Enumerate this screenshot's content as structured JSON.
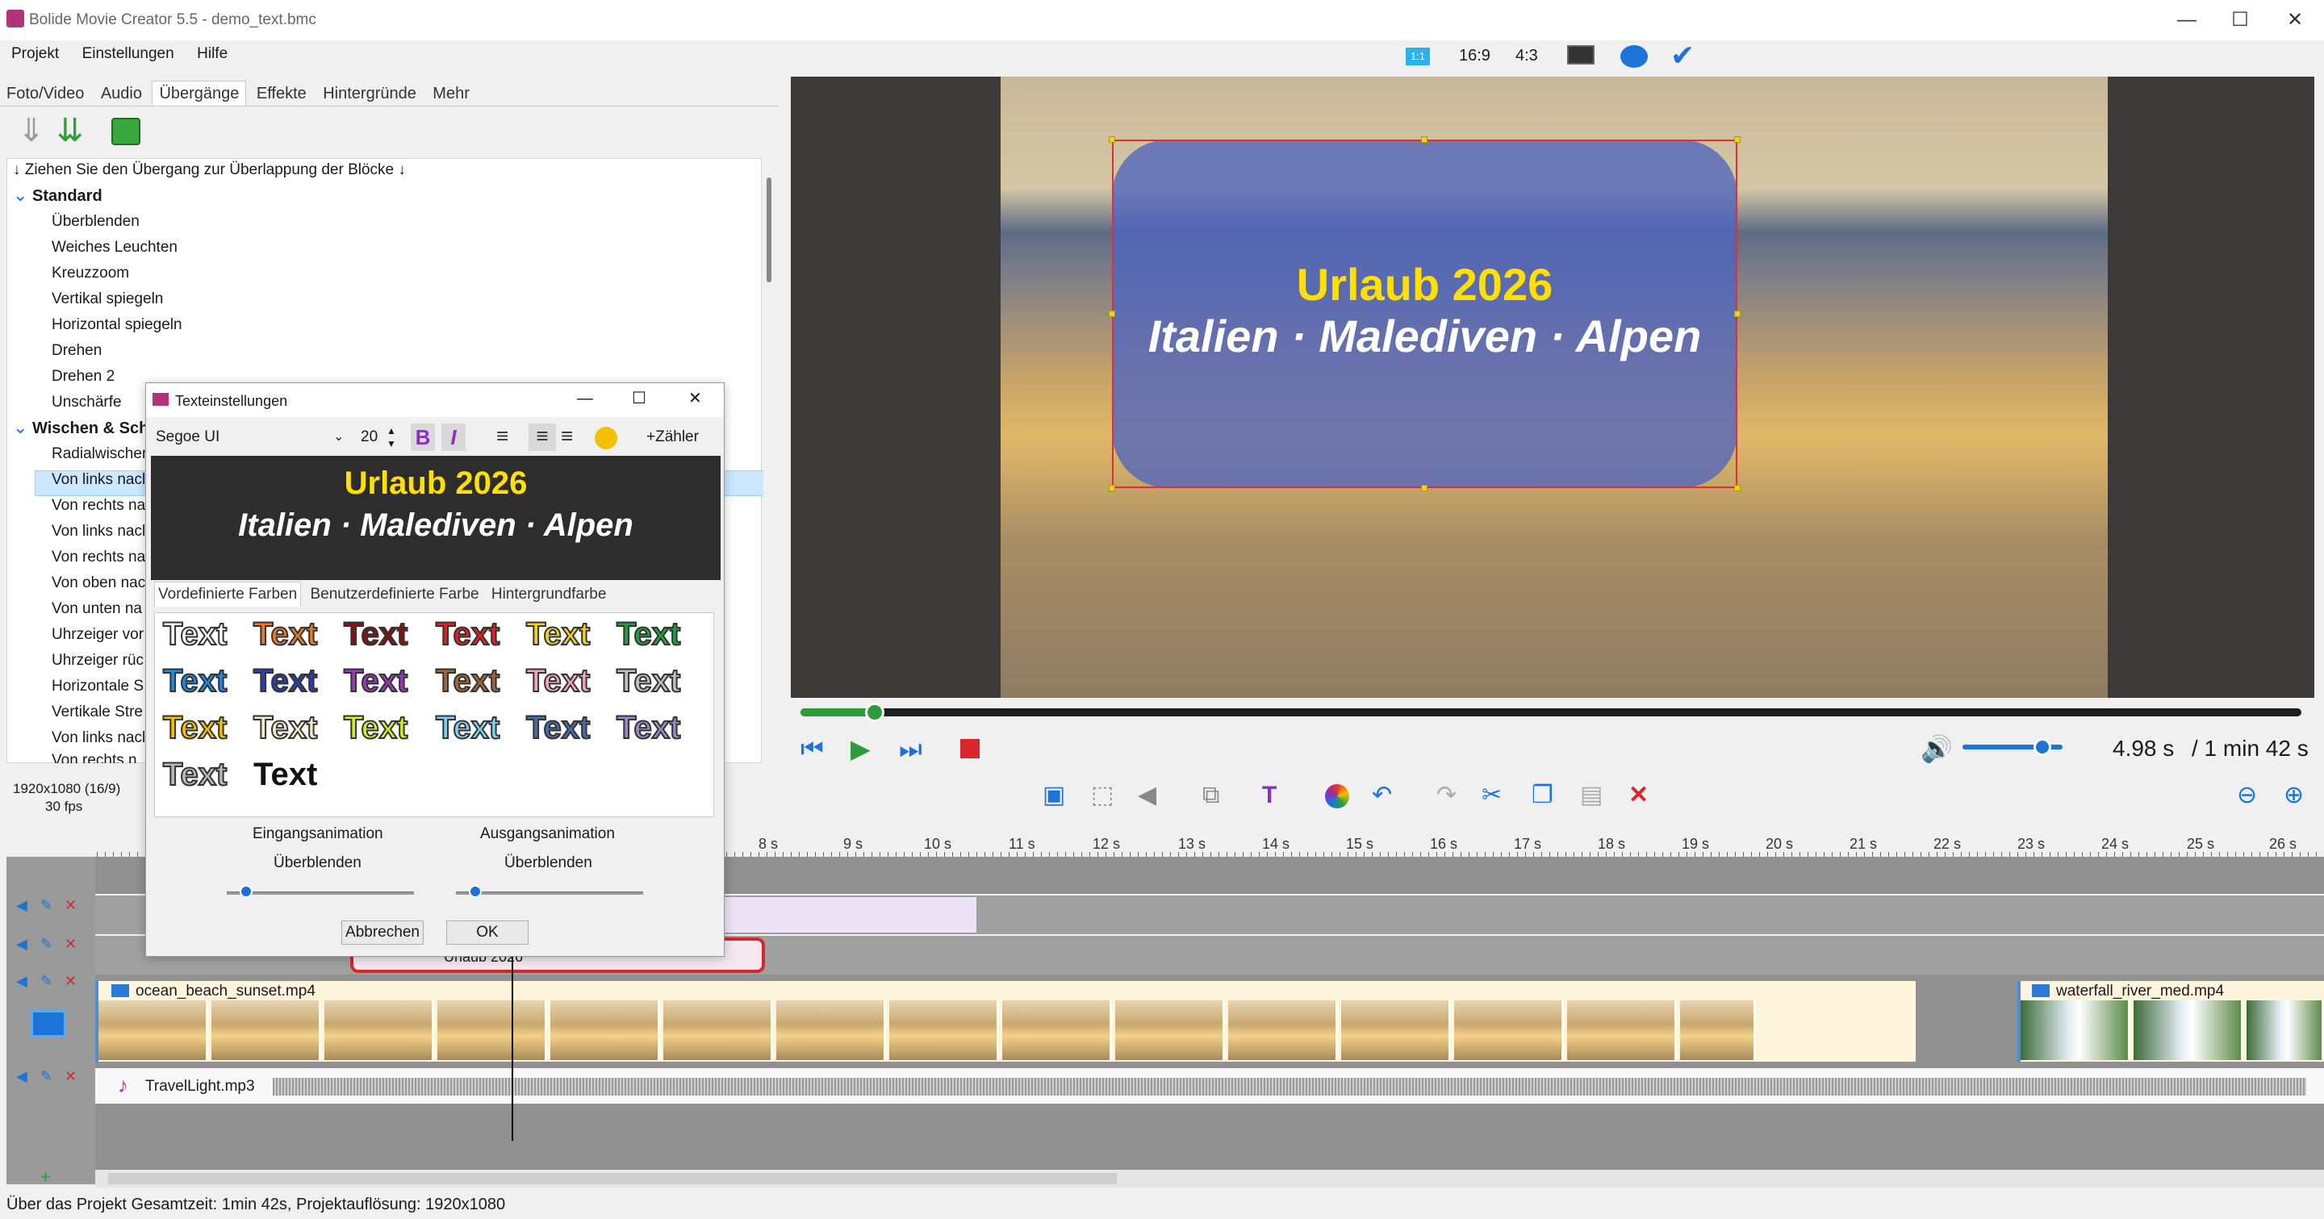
{
  "window": {
    "title": "Bolide Movie Creator 5.5 - demo_text.bmc",
    "minimize": "—",
    "maximize": "☐",
    "close": "✕"
  },
  "menu": [
    "Projekt",
    "Einstellungen",
    "Hilfe"
  ],
  "aspect_buttons": {
    "a1": "1:1",
    "a2": "16:9",
    "a3": "4:3"
  },
  "tabs": [
    "Foto/Video",
    "Audio",
    "Übergänge",
    "Effekte",
    "Hintergründe",
    "Mehr"
  ],
  "transitions": {
    "hint": "↓ Ziehen Sie den Übergang zur Überlappung der Blöcke ↓",
    "cat1": "Standard",
    "std": [
      "Überblenden",
      "Weiches Leuchten",
      "Kreuzzoom",
      "Vertikal spiegeln",
      "Horizontal spiegeln",
      "Drehen",
      "Drehen 2",
      "Unschärfe"
    ],
    "cat2": "Wischen & Sch",
    "wipe": [
      "Radialwischer",
      "Von links nacl",
      "Von rechts na",
      "Von links nacl",
      "Von rechts na",
      "Von oben nac",
      "Von unten na",
      "Uhrzeiger vor",
      "Uhrzeiger rüc",
      "Horizontale S",
      "Vertikale Stre",
      "Von links nacl",
      "Von rechts n"
    ]
  },
  "resolution": {
    "res": "1920x1080 (16/9)",
    "fps": "30 fps"
  },
  "preview": {
    "title": "Urlaub 2026",
    "subtitle": "Italien · Malediven · Alpen"
  },
  "playback": {
    "current": "4.98 s",
    "total": "/ 1 min 42 s",
    "progress": 0.05,
    "volume": 0.9
  },
  "ruler": [
    "8 s",
    "9 s",
    "10 s",
    "11 s",
    "12 s",
    "13 s",
    "14 s",
    "15 s",
    "16 s",
    "17 s",
    "18 s",
    "19 s",
    "20 s",
    "21 s",
    "22 s",
    "23 s",
    "24 s",
    "25 s",
    "26 s"
  ],
  "clips": {
    "video1": "ocean_beach_sunset.mp4",
    "video2": "waterfall_river_med.mp4",
    "audio": "TravelLight.mp3",
    "text": "Urlaub 2026"
  },
  "dialog": {
    "title": "Texteinstellungen",
    "font": "Segoe UI",
    "size": "20",
    "counter": "+Zähler",
    "preview_title": "Urlaub 2026",
    "preview_sub": "Italien · Malediven · Alpen",
    "tabs": [
      "Vordefinierte Farben",
      "Benutzerdefinierte Farbe",
      "Hintergrundfarbe"
    ],
    "swatch_label": "Text",
    "in_label": "Eingangsanimation",
    "in_value": "Überblenden",
    "out_label": "Ausgangsanimation",
    "out_value": "Überblenden",
    "cancel": "Abbrechen",
    "ok": "OK"
  },
  "status": {
    "text": "Über das Projekt Gesamtzeit: 1min 42s,   Projektauflösung:  1920x1080"
  },
  "colors": {
    "accent": "#2e9b3b",
    "selection": "#cce8ff",
    "brand_red": "#d8262b"
  }
}
